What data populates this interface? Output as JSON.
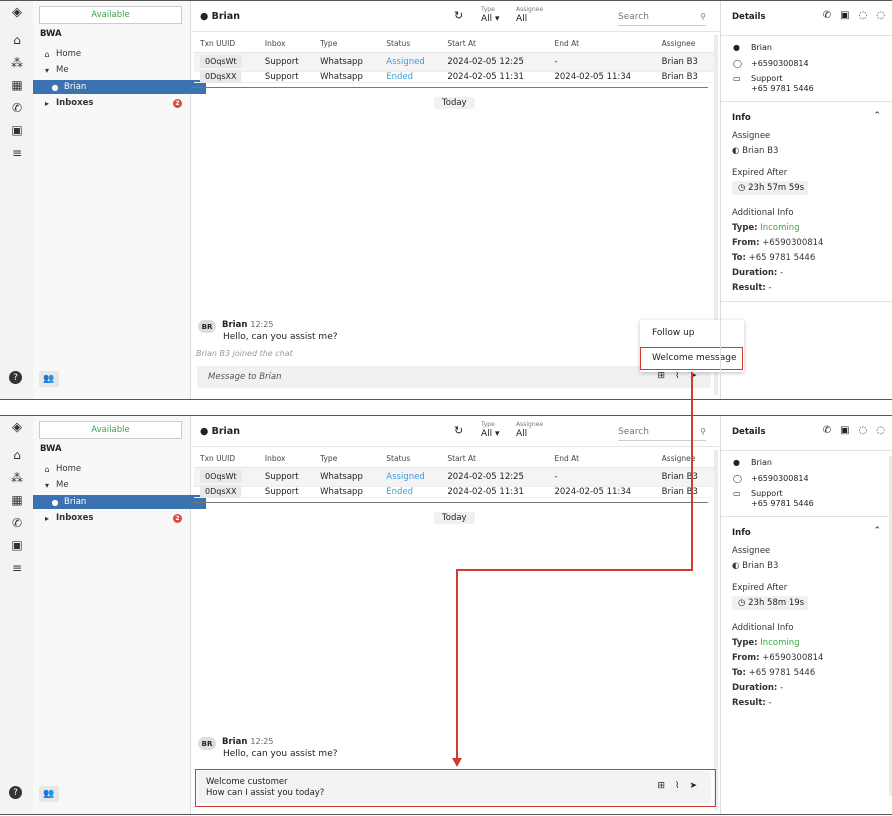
{
  "status": "Available",
  "org": "BWA",
  "nav": {
    "home": "Home",
    "me": "Me",
    "user": "Brian",
    "inboxes": "Inboxes",
    "inboxes_badge": "2"
  },
  "conversation": {
    "contact": "Brian",
    "type_label": "Type",
    "type_value": "All",
    "assignee_label": "Assignee",
    "assignee_value": "All",
    "search_placeholder": "Search"
  },
  "table": {
    "headers": [
      "Txn UUID",
      "Inbox",
      "Type",
      "Status",
      "Start At",
      "End At",
      "Assignee"
    ],
    "rows": [
      [
        "0OqsWt",
        "Support",
        "Whatsapp",
        "Assigned",
        "2024-02-05 12:25",
        "-",
        "Brian B3"
      ],
      [
        "0DqsXX",
        "Support",
        "Whatsapp",
        "Ended",
        "2024-02-05 11:31",
        "2024-02-05 11:34",
        "Brian B3"
      ]
    ]
  },
  "chat": {
    "date_divider": "Today",
    "avatar_initials": "BR",
    "sender": "Brian",
    "time": "12:25",
    "message": "Hello, can you assist me?",
    "joined": "Brian B3 joined the chat",
    "placeholder": "Message to Brian",
    "composer_text_line1": "Welcome customer",
    "composer_text_line2": "How can I assist you today?"
  },
  "quick_replies": [
    "Follow up",
    "Welcome message"
  ],
  "details": {
    "title": "Details",
    "name": "Brian",
    "phone": "+6590300814",
    "inbox": "Support",
    "inbox_number": "+65 9781 5446"
  },
  "info": {
    "title": "Info",
    "assignee_label": "Assignee",
    "assignee": "Brian B3",
    "expired_label": "Expired After",
    "timer_before": "23h 57m 59s",
    "timer_after": "23h 58m 19s",
    "additional_label": "Additional Info",
    "type_key": "Type:",
    "type_value": "Incoming",
    "from_key": "From:",
    "from_value": "+6590300814",
    "to_key": "To:",
    "to_value": "+65 9781 5446",
    "duration_key": "Duration:",
    "duration_value": "-",
    "result_key": "Result:",
    "result_value": "-"
  },
  "colors": {
    "accent": "#3a73b0",
    "highlight": "#d23b2d",
    "assigned": "#3a9fd8",
    "incoming": "#3aa24a"
  }
}
